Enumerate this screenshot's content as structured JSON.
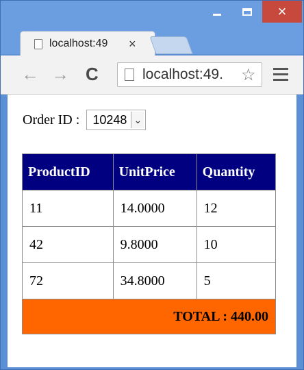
{
  "browser": {
    "tab_title": "localhost:49",
    "tab_close": "×",
    "address": "localhost:49.",
    "minimize_icon": "minimize-icon",
    "maximize_icon": "maximize-icon",
    "close_label": "×",
    "back_glyph": "←",
    "forward_glyph": "→",
    "reload_glyph": "C",
    "star_glyph": "☆"
  },
  "form": {
    "order_label": "Order ID :",
    "order_value": "10248"
  },
  "table": {
    "headers": [
      "ProductID",
      "UnitPrice",
      "Quantity"
    ],
    "rows": [
      [
        "11",
        "14.0000",
        "12"
      ],
      [
        "42",
        "9.8000",
        "10"
      ],
      [
        "72",
        "34.8000",
        "5"
      ]
    ],
    "total": "TOTAL : 440.00"
  },
  "colors": {
    "header_bg": "#000080",
    "total_bg": "#FF6600",
    "titlebar": "#6A9EE0",
    "close_button": "#C7483C"
  }
}
